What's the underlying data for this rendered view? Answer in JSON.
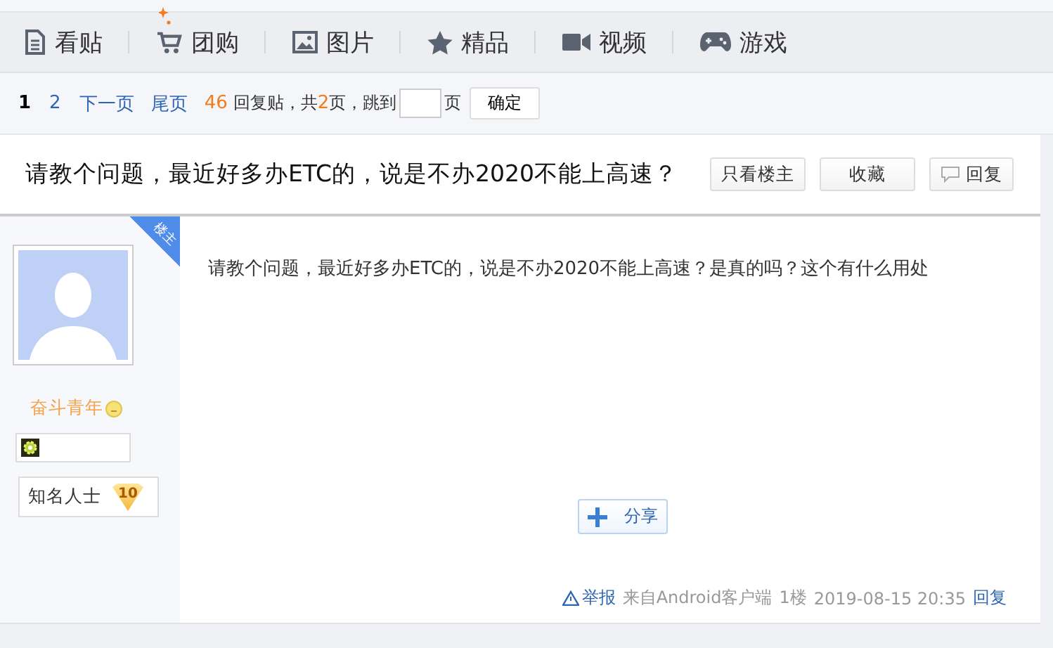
{
  "nav": {
    "items": [
      {
        "label": "看贴"
      },
      {
        "label": "团购"
      },
      {
        "label": "图片"
      },
      {
        "label": "精品"
      },
      {
        "label": "视频"
      },
      {
        "label": "游戏"
      }
    ]
  },
  "pager": {
    "pages": [
      {
        "label": "1",
        "selected": true
      },
      {
        "label": "2",
        "selected": false
      }
    ],
    "links": [
      "下一页",
      "尾页"
    ],
    "reply_count": "46",
    "reply_text": "回复贴，共",
    "page_count": "2",
    "jump_text": "页，跳到",
    "page_unit": "页",
    "confirm": "确定"
  },
  "thread": {
    "title": "请教个问题，最近好多办ETC的，说是不办2020不能上高速？",
    "buttons": [
      {
        "label": "只看楼主"
      },
      {
        "label": "收藏"
      },
      {
        "label": "回复"
      }
    ]
  },
  "post": {
    "ribbon": "楼主",
    "username": "奋斗青年",
    "rank": "知名人士",
    "level": "10",
    "body": "请教个问题，最近好多办ETC的，说是不办2020不能上高速？是真的吗？这个有什么用处",
    "share": "分享",
    "report": "举报",
    "source": "来自Android客户端",
    "floor": "1楼",
    "time": "2019-08-15 20:35",
    "reply": "回复"
  }
}
